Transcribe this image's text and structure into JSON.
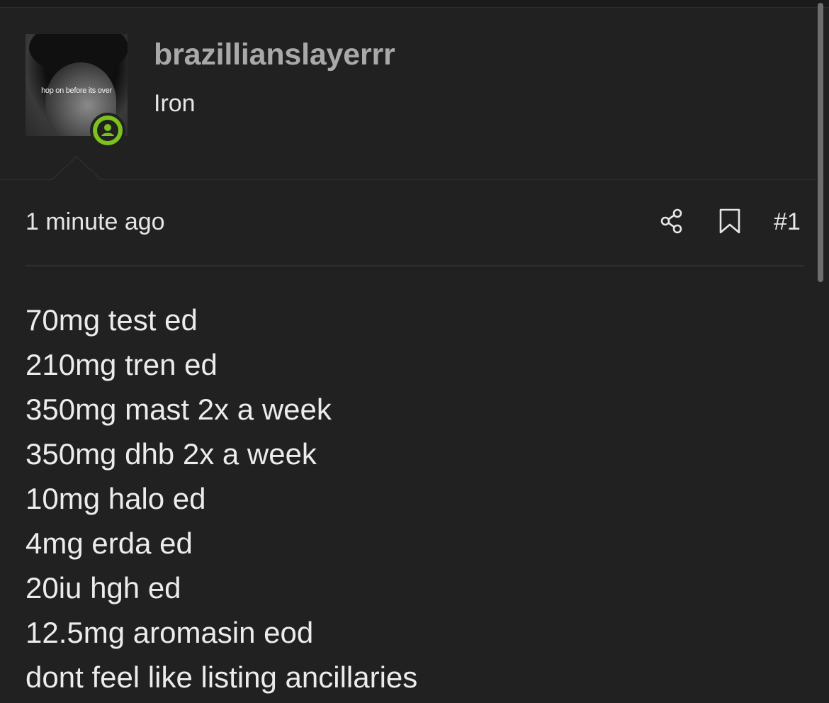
{
  "user": {
    "avatar_caption": "hop on before its over",
    "username": "brazillianslayerrr",
    "rank": "Iron"
  },
  "post": {
    "timestamp": "1 minute ago",
    "number": "#1",
    "lines": [
      "70mg test ed",
      "210mg tren ed",
      "350mg mast 2x a week",
      "350mg dhb 2x a week",
      "10mg halo ed",
      "4mg erda ed",
      "20iu hgh ed",
      "12.5mg aromasin eod",
      "dont feel like listing ancillaries"
    ]
  },
  "icons": {
    "status": "user-circle-icon",
    "share": "share-icon",
    "bookmark": "bookmark-icon"
  },
  "colors": {
    "background": "#212121",
    "status_green": "#7cc21a",
    "username": "#a9a9a9",
    "text": "#e6e6e6",
    "divider": "#2f2f2f"
  }
}
